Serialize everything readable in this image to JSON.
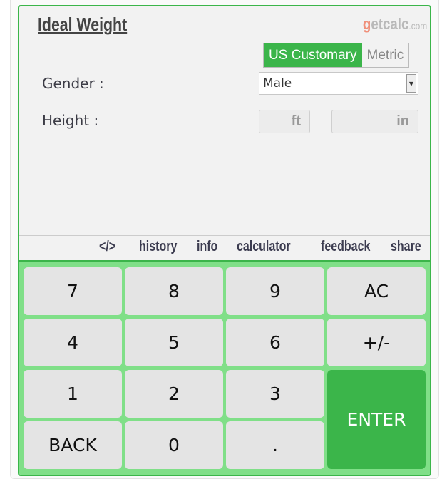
{
  "title": "Ideal Weight",
  "logo": "getcalc.com",
  "units": {
    "active": "US Customary",
    "inactive": "Metric"
  },
  "form": {
    "gender_label": "Gender :",
    "gender_value": "Male",
    "height_label": "Height :",
    "ft_placeholder": "ft",
    "in_placeholder": "in"
  },
  "links": [
    "</>",
    "history",
    "info",
    "calculator",
    "feedback",
    "share"
  ],
  "keys": [
    "7",
    "8",
    "9",
    "AC",
    "4",
    "5",
    "6",
    "+/-",
    "1",
    "2",
    "3",
    "ENTER",
    "BACK",
    "0",
    "."
  ],
  "colors": {
    "accent": "#3bb54a",
    "keypad": "#80df88"
  }
}
